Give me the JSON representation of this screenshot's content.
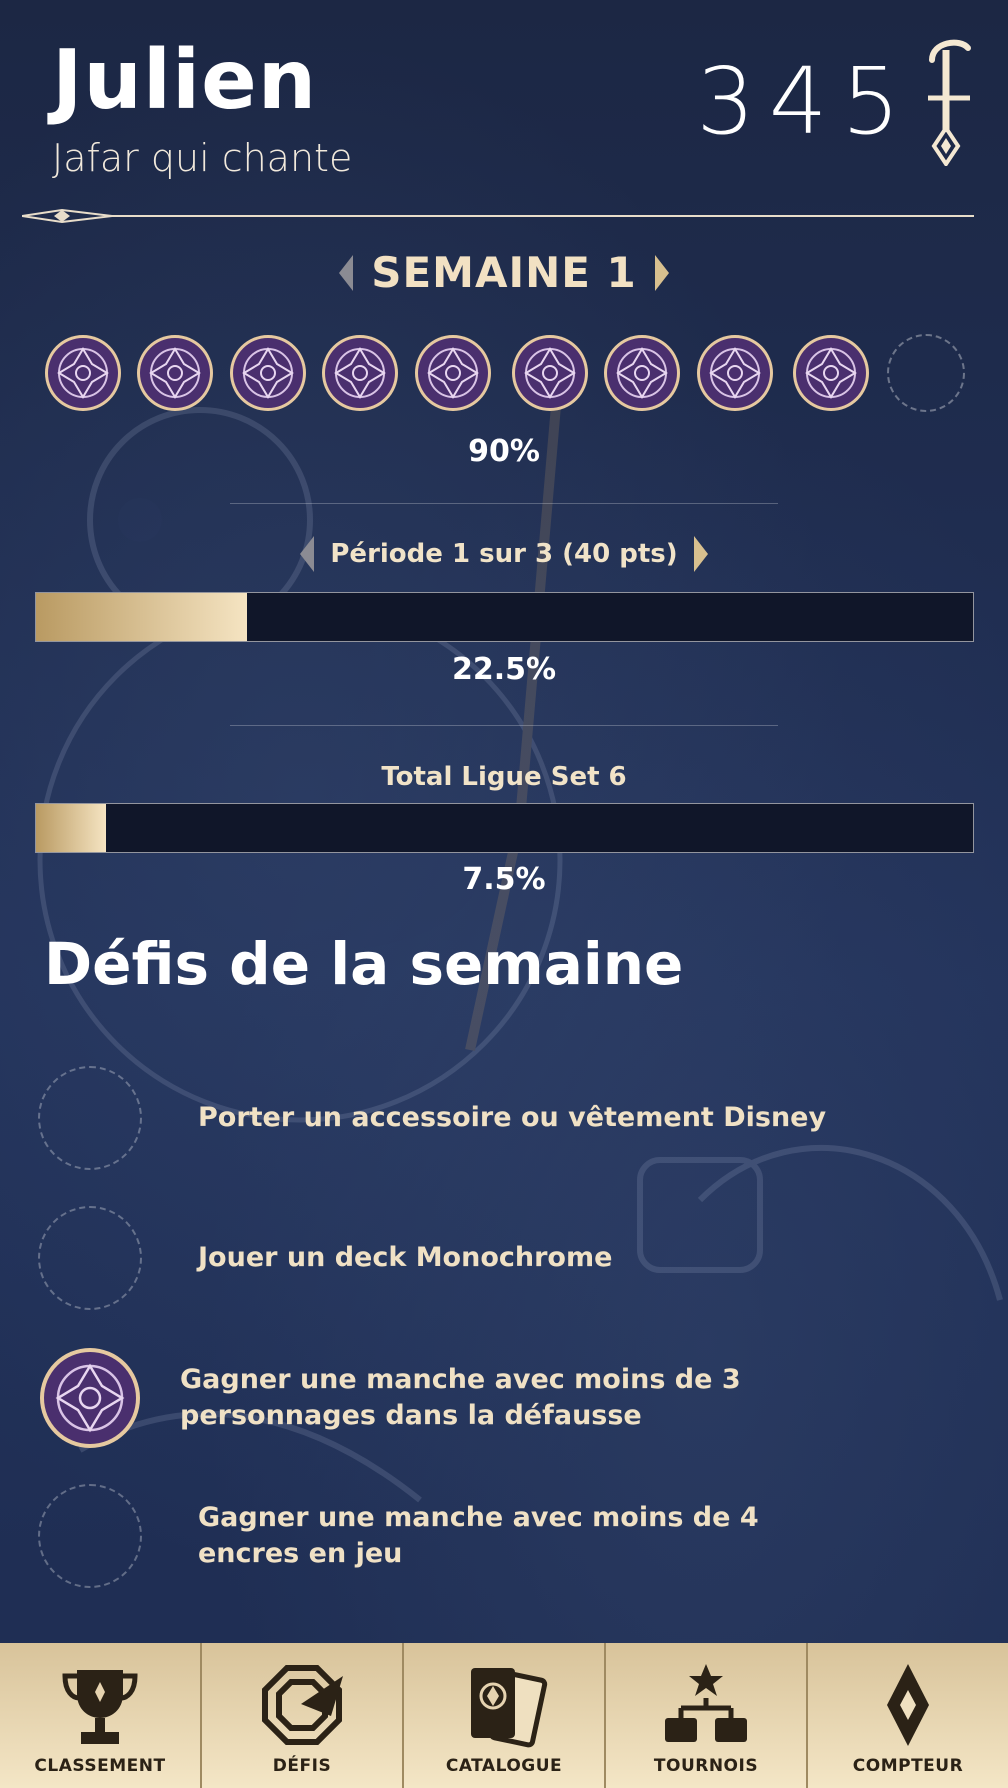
{
  "header": {
    "player_name": "Julien",
    "deck_name": "Jafar qui chante",
    "lore_value": "345",
    "lore_icon": "lore-quill-icon"
  },
  "week": {
    "label": "SEMAINE 1",
    "tokens_total": 10,
    "tokens_earned": 9,
    "percent_label": "90%"
  },
  "period": {
    "label": "Période 1 sur 3 (40 pts)",
    "progress": 0.225,
    "percent_label": "22.5%"
  },
  "league": {
    "label": "Total Ligue Set 6",
    "progress": 0.075,
    "percent_label": "7.5%"
  },
  "challenges": {
    "title": "Défis de la semaine",
    "items": [
      {
        "text": "Porter un accessoire ou vêtement Disney",
        "completed": false
      },
      {
        "text": "Jouer un deck Monochrome",
        "completed": false
      },
      {
        "text": "Gagner une manche avec moins de 3 personnages dans la défausse",
        "completed": true
      },
      {
        "text": "Gagner une manche avec moins de 4 encres en jeu",
        "completed": false
      }
    ]
  },
  "tabs": [
    {
      "label": "CLASSEMENT",
      "icon": "trophy-icon"
    },
    {
      "label": "DÉFIS",
      "icon": "challenges-icon"
    },
    {
      "label": "CATALOGUE",
      "icon": "cards-icon"
    },
    {
      "label": "TOURNOIS",
      "icon": "bracket-icon"
    },
    {
      "label": "COMPTEUR",
      "icon": "lore-counter-icon"
    }
  ],
  "colors": {
    "background": "#1d2a49",
    "gold_light": "#f5e4c2",
    "gold_dark": "#b99a62",
    "token_purple": "#4a2f6e"
  }
}
